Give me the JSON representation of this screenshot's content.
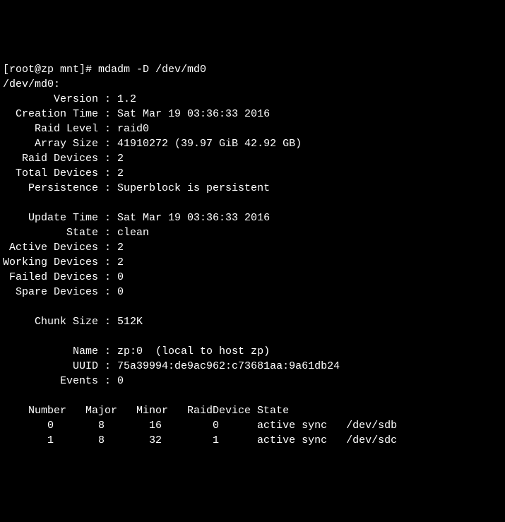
{
  "prompt": "[root@zp mnt]# ",
  "command": "mdadm -D /dev/md0",
  "device": "/dev/md0:",
  "fields": {
    "version_label": "        Version : ",
    "version_value": "1.2",
    "creation_time_label": "  Creation Time : ",
    "creation_time_value": "Sat Mar 19 03:36:33 2016",
    "raid_level_label": "     Raid Level : ",
    "raid_level_value": "raid0",
    "array_size_label": "     Array Size : ",
    "array_size_value": "41910272 (39.97 GiB 42.92 GB)",
    "raid_devices_label": "   Raid Devices : ",
    "raid_devices_value": "2",
    "total_devices_label": "  Total Devices : ",
    "total_devices_value": "2",
    "persistence_label": "    Persistence : ",
    "persistence_value": "Superblock is persistent",
    "update_time_label": "    Update Time : ",
    "update_time_value": "Sat Mar 19 03:36:33 2016",
    "state_label": "          State : ",
    "state_value": "clean ",
    "active_devices_label": " Active Devices : ",
    "active_devices_value": "2",
    "working_devices_label": "Working Devices : ",
    "working_devices_value": "2",
    "failed_devices_label": " Failed Devices : ",
    "failed_devices_value": "0",
    "spare_devices_label": "  Spare Devices : ",
    "spare_devices_value": "0",
    "chunk_size_label": "     Chunk Size : ",
    "chunk_size_value": "512K",
    "name_label": "           Name : ",
    "name_value": "zp:0  (local to host zp)",
    "uuid_label": "           UUID : ",
    "uuid_value": "75a39994:de9ac962:c73681aa:9a61db24",
    "events_label": "         Events : ",
    "events_value": "0"
  },
  "table": {
    "header": "    Number   Major   Minor   RaidDevice State",
    "rows": [
      "       0       8       16        0      active sync   /dev/sdb",
      "       1       8       32        1      active sync   /dev/sdc"
    ]
  }
}
